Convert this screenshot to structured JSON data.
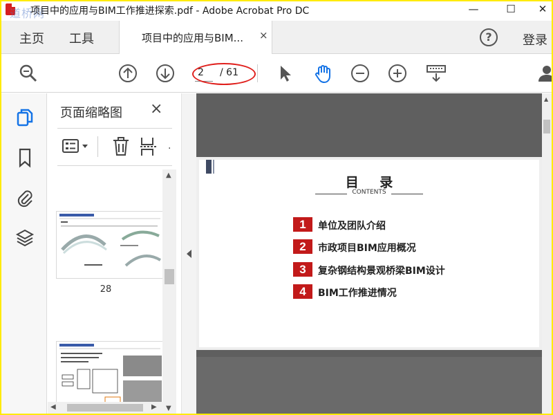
{
  "window": {
    "title": "项目中的应用与BIM工作推进探索.pdf - Adobe Acrobat Pro DC",
    "watermark": "道桥网",
    "controls": {
      "minimize": "—",
      "maximize": "☐",
      "close": "✕"
    }
  },
  "topnav": {
    "home": "主页",
    "tools": "工具",
    "doc_tab": "项目中的应用与BIM...",
    "doc_tab_close": "×",
    "help": "?",
    "login": "登录"
  },
  "toolbar": {
    "page_current": "2",
    "page_total": "/ 61",
    "icons": [
      "search-icon",
      "page-up-icon",
      "page-down-icon",
      "select-arrow-icon",
      "hand-tool-icon",
      "zoom-out-icon",
      "zoom-in-icon",
      "keyboard-icon",
      "user-icon"
    ],
    "highlight_color": "#e0201d"
  },
  "sidebar": {
    "panel_title": "页面缩略图",
    "panel_close": "×",
    "rail_icons": [
      "page-thumbnails-icon",
      "bookmark-icon",
      "attachment-icon",
      "layers-icon"
    ],
    "thumbnails": [
      {
        "label": "28"
      }
    ]
  },
  "document": {
    "toc_title": "目 录",
    "toc_subtitle": "CONTENTS",
    "toc_items": [
      {
        "num": "1",
        "text": "单位及团队介绍"
      },
      {
        "num": "2",
        "text": "市政项目BIM应用概况"
      },
      {
        "num": "3",
        "text": "复杂钢结构景观桥梁BIM设计"
      },
      {
        "num": "4",
        "text": "BIM工作推进情况"
      }
    ],
    "accent_color": "#c21a1a"
  }
}
